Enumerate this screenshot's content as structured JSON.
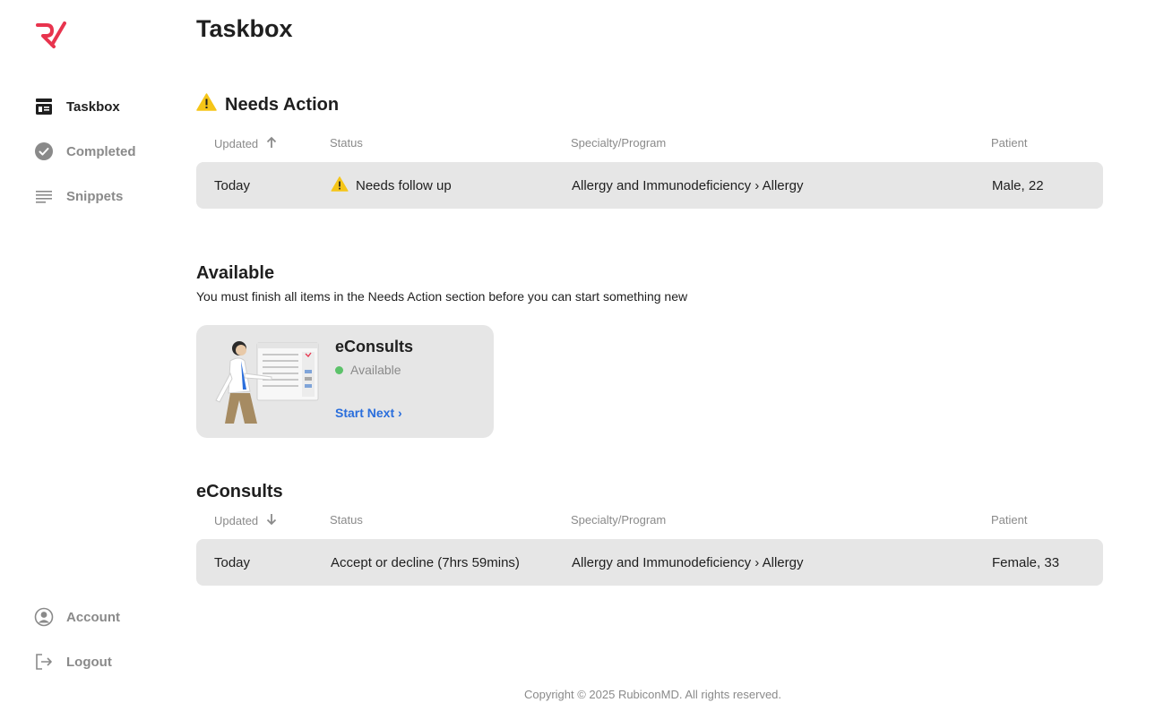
{
  "app": {
    "logo_name": "rubicon-logo",
    "brand_color": "#e8344e",
    "accent_color": "#2a6edc"
  },
  "sidebar": {
    "items": [
      {
        "label": "Taskbox",
        "icon": "taskbox-icon",
        "active": true
      },
      {
        "label": "Completed",
        "icon": "check-circle-icon",
        "active": false
      },
      {
        "label": "Snippets",
        "icon": "lines-icon",
        "active": false
      }
    ],
    "bottom_items": [
      {
        "label": "Account",
        "icon": "user-circle-icon"
      },
      {
        "label": "Logout",
        "icon": "logout-icon"
      }
    ]
  },
  "page": {
    "title": "Taskbox"
  },
  "needs_action": {
    "title": "Needs Action",
    "columns": {
      "updated": "Updated",
      "status": "Status",
      "specialty": "Specialty/Program",
      "patient": "Patient"
    },
    "rows": [
      {
        "updated": "Today",
        "status": "Needs follow up",
        "specialty": "Allergy and Immunodeficiency › Allergy",
        "patient": "Male, 22"
      }
    ]
  },
  "available": {
    "title": "Available",
    "subtitle": "You must finish all items in the Needs Action section before you can start something new",
    "card": {
      "title": "eConsults",
      "status": "Available",
      "link": "Start Next ›"
    }
  },
  "econsults": {
    "title": "eConsults",
    "columns": {
      "updated": "Updated",
      "status": "Status",
      "specialty": "Specialty/Program",
      "patient": "Patient"
    },
    "rows": [
      {
        "updated": "Today",
        "status": "Accept or decline (7hrs 59mins)",
        "specialty": "Allergy and Immunodeficiency › Allergy",
        "patient": "Female, 33"
      }
    ]
  },
  "footer": {
    "copyright": "Copyright © 2025 RubiconMD. All rights reserved."
  }
}
